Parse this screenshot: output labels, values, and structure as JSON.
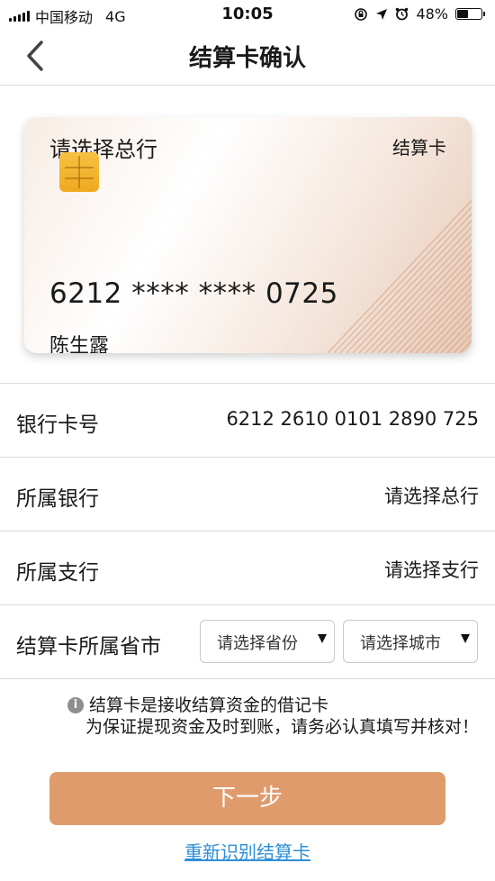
{
  "status_bar": {
    "carrier": "中国移动",
    "network": "4G",
    "time": "10:05",
    "battery": "48%",
    "battery_level": 0.48
  },
  "nav": {
    "title": "结算卡确认",
    "back_icon": "chevron-left-icon"
  },
  "card": {
    "bank": "请选择总行",
    "type": "结算卡",
    "number": "6212 **** **** 0725",
    "holder": "陈生露"
  },
  "rows": {
    "card_number": {
      "label": "银行卡号",
      "value": "6212 2610 0101 2890 725"
    },
    "bank": {
      "label": "所属银行",
      "value": "请选择总行"
    },
    "branch": {
      "label": "所属支行",
      "value": "请选择支行"
    },
    "region": {
      "label": "结算卡所属省市",
      "province_placeholder": "请选择省份",
      "city_placeholder": "请选择城市"
    }
  },
  "notice": {
    "line1": "结算卡是接收结算资金的借记卡",
    "line2": "为保证提现资金及时到账，请务必认真填写并核对！"
  },
  "next_button": "下一步",
  "rescan_link": "重新识别结算卡",
  "colors": {
    "accent": "#e09b6c",
    "link": "#2f8fd8",
    "chip": "#f1b230"
  }
}
